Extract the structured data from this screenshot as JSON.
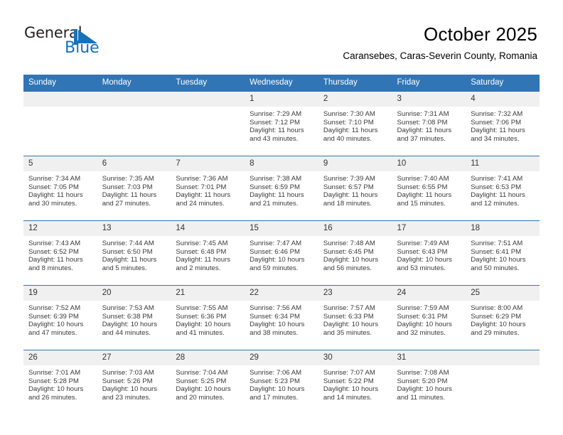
{
  "logo": {
    "text_general": "General",
    "text_blue": "Blue",
    "flag_icon": "blue-triangle-flag-icon",
    "blue_hex": "#1573bd"
  },
  "header": {
    "month_title": "October 2025",
    "location": "Caransebes, Caras-Severin County, Romania"
  },
  "theme": {
    "header_blue": "#3175b4",
    "daynum_bg": "#f0f0f0",
    "text": "#3a3a3a"
  },
  "calendar": {
    "weekday_headers": [
      "Sunday",
      "Monday",
      "Tuesday",
      "Wednesday",
      "Thursday",
      "Friday",
      "Saturday"
    ],
    "weeks": [
      [
        {
          "day": "",
          "blank": true,
          "sunrise": "",
          "sunset": "",
          "daylight1": "",
          "daylight2": ""
        },
        {
          "day": "",
          "blank": true,
          "sunrise": "",
          "sunset": "",
          "daylight1": "",
          "daylight2": ""
        },
        {
          "day": "",
          "blank": true,
          "sunrise": "",
          "sunset": "",
          "daylight1": "",
          "daylight2": ""
        },
        {
          "day": "1",
          "blank": false,
          "sunrise": "Sunrise: 7:29 AM",
          "sunset": "Sunset: 7:12 PM",
          "daylight1": "Daylight: 11 hours",
          "daylight2": "and 43 minutes."
        },
        {
          "day": "2",
          "blank": false,
          "sunrise": "Sunrise: 7:30 AM",
          "sunset": "Sunset: 7:10 PM",
          "daylight1": "Daylight: 11 hours",
          "daylight2": "and 40 minutes."
        },
        {
          "day": "3",
          "blank": false,
          "sunrise": "Sunrise: 7:31 AM",
          "sunset": "Sunset: 7:08 PM",
          "daylight1": "Daylight: 11 hours",
          "daylight2": "and 37 minutes."
        },
        {
          "day": "4",
          "blank": false,
          "sunrise": "Sunrise: 7:32 AM",
          "sunset": "Sunset: 7:06 PM",
          "daylight1": "Daylight: 11 hours",
          "daylight2": "and 34 minutes."
        }
      ],
      [
        {
          "day": "5",
          "blank": false,
          "sunrise": "Sunrise: 7:34 AM",
          "sunset": "Sunset: 7:05 PM",
          "daylight1": "Daylight: 11 hours",
          "daylight2": "and 30 minutes."
        },
        {
          "day": "6",
          "blank": false,
          "sunrise": "Sunrise: 7:35 AM",
          "sunset": "Sunset: 7:03 PM",
          "daylight1": "Daylight: 11 hours",
          "daylight2": "and 27 minutes."
        },
        {
          "day": "7",
          "blank": false,
          "sunrise": "Sunrise: 7:36 AM",
          "sunset": "Sunset: 7:01 PM",
          "daylight1": "Daylight: 11 hours",
          "daylight2": "and 24 minutes."
        },
        {
          "day": "8",
          "blank": false,
          "sunrise": "Sunrise: 7:38 AM",
          "sunset": "Sunset: 6:59 PM",
          "daylight1": "Daylight: 11 hours",
          "daylight2": "and 21 minutes."
        },
        {
          "day": "9",
          "blank": false,
          "sunrise": "Sunrise: 7:39 AM",
          "sunset": "Sunset: 6:57 PM",
          "daylight1": "Daylight: 11 hours",
          "daylight2": "and 18 minutes."
        },
        {
          "day": "10",
          "blank": false,
          "sunrise": "Sunrise: 7:40 AM",
          "sunset": "Sunset: 6:55 PM",
          "daylight1": "Daylight: 11 hours",
          "daylight2": "and 15 minutes."
        },
        {
          "day": "11",
          "blank": false,
          "sunrise": "Sunrise: 7:41 AM",
          "sunset": "Sunset: 6:53 PM",
          "daylight1": "Daylight: 11 hours",
          "daylight2": "and 12 minutes."
        }
      ],
      [
        {
          "day": "12",
          "blank": false,
          "sunrise": "Sunrise: 7:43 AM",
          "sunset": "Sunset: 6:52 PM",
          "daylight1": "Daylight: 11 hours",
          "daylight2": "and 8 minutes."
        },
        {
          "day": "13",
          "blank": false,
          "sunrise": "Sunrise: 7:44 AM",
          "sunset": "Sunset: 6:50 PM",
          "daylight1": "Daylight: 11 hours",
          "daylight2": "and 5 minutes."
        },
        {
          "day": "14",
          "blank": false,
          "sunrise": "Sunrise: 7:45 AM",
          "sunset": "Sunset: 6:48 PM",
          "daylight1": "Daylight: 11 hours",
          "daylight2": "and 2 minutes."
        },
        {
          "day": "15",
          "blank": false,
          "sunrise": "Sunrise: 7:47 AM",
          "sunset": "Sunset: 6:46 PM",
          "daylight1": "Daylight: 10 hours",
          "daylight2": "and 59 minutes."
        },
        {
          "day": "16",
          "blank": false,
          "sunrise": "Sunrise: 7:48 AM",
          "sunset": "Sunset: 6:45 PM",
          "daylight1": "Daylight: 10 hours",
          "daylight2": "and 56 minutes."
        },
        {
          "day": "17",
          "blank": false,
          "sunrise": "Sunrise: 7:49 AM",
          "sunset": "Sunset: 6:43 PM",
          "daylight1": "Daylight: 10 hours",
          "daylight2": "and 53 minutes."
        },
        {
          "day": "18",
          "blank": false,
          "sunrise": "Sunrise: 7:51 AM",
          "sunset": "Sunset: 6:41 PM",
          "daylight1": "Daylight: 10 hours",
          "daylight2": "and 50 minutes."
        }
      ],
      [
        {
          "day": "19",
          "blank": false,
          "sunrise": "Sunrise: 7:52 AM",
          "sunset": "Sunset: 6:39 PM",
          "daylight1": "Daylight: 10 hours",
          "daylight2": "and 47 minutes."
        },
        {
          "day": "20",
          "blank": false,
          "sunrise": "Sunrise: 7:53 AM",
          "sunset": "Sunset: 6:38 PM",
          "daylight1": "Daylight: 10 hours",
          "daylight2": "and 44 minutes."
        },
        {
          "day": "21",
          "blank": false,
          "sunrise": "Sunrise: 7:55 AM",
          "sunset": "Sunset: 6:36 PM",
          "daylight1": "Daylight: 10 hours",
          "daylight2": "and 41 minutes."
        },
        {
          "day": "22",
          "blank": false,
          "sunrise": "Sunrise: 7:56 AM",
          "sunset": "Sunset: 6:34 PM",
          "daylight1": "Daylight: 10 hours",
          "daylight2": "and 38 minutes."
        },
        {
          "day": "23",
          "blank": false,
          "sunrise": "Sunrise: 7:57 AM",
          "sunset": "Sunset: 6:33 PM",
          "daylight1": "Daylight: 10 hours",
          "daylight2": "and 35 minutes."
        },
        {
          "day": "24",
          "blank": false,
          "sunrise": "Sunrise: 7:59 AM",
          "sunset": "Sunset: 6:31 PM",
          "daylight1": "Daylight: 10 hours",
          "daylight2": "and 32 minutes."
        },
        {
          "day": "25",
          "blank": false,
          "sunrise": "Sunrise: 8:00 AM",
          "sunset": "Sunset: 6:29 PM",
          "daylight1": "Daylight: 10 hours",
          "daylight2": "and 29 minutes."
        }
      ],
      [
        {
          "day": "26",
          "blank": false,
          "sunrise": "Sunrise: 7:01 AM",
          "sunset": "Sunset: 5:28 PM",
          "daylight1": "Daylight: 10 hours",
          "daylight2": "and 26 minutes."
        },
        {
          "day": "27",
          "blank": false,
          "sunrise": "Sunrise: 7:03 AM",
          "sunset": "Sunset: 5:26 PM",
          "daylight1": "Daylight: 10 hours",
          "daylight2": "and 23 minutes."
        },
        {
          "day": "28",
          "blank": false,
          "sunrise": "Sunrise: 7:04 AM",
          "sunset": "Sunset: 5:25 PM",
          "daylight1": "Daylight: 10 hours",
          "daylight2": "and 20 minutes."
        },
        {
          "day": "29",
          "blank": false,
          "sunrise": "Sunrise: 7:06 AM",
          "sunset": "Sunset: 5:23 PM",
          "daylight1": "Daylight: 10 hours",
          "daylight2": "and 17 minutes."
        },
        {
          "day": "30",
          "blank": false,
          "sunrise": "Sunrise: 7:07 AM",
          "sunset": "Sunset: 5:22 PM",
          "daylight1": "Daylight: 10 hours",
          "daylight2": "and 14 minutes."
        },
        {
          "day": "31",
          "blank": false,
          "sunrise": "Sunrise: 7:08 AM",
          "sunset": "Sunset: 5:20 PM",
          "daylight1": "Daylight: 10 hours",
          "daylight2": "and 11 minutes."
        },
        {
          "day": "",
          "blank": true,
          "sunrise": "",
          "sunset": "",
          "daylight1": "",
          "daylight2": ""
        }
      ]
    ]
  }
}
